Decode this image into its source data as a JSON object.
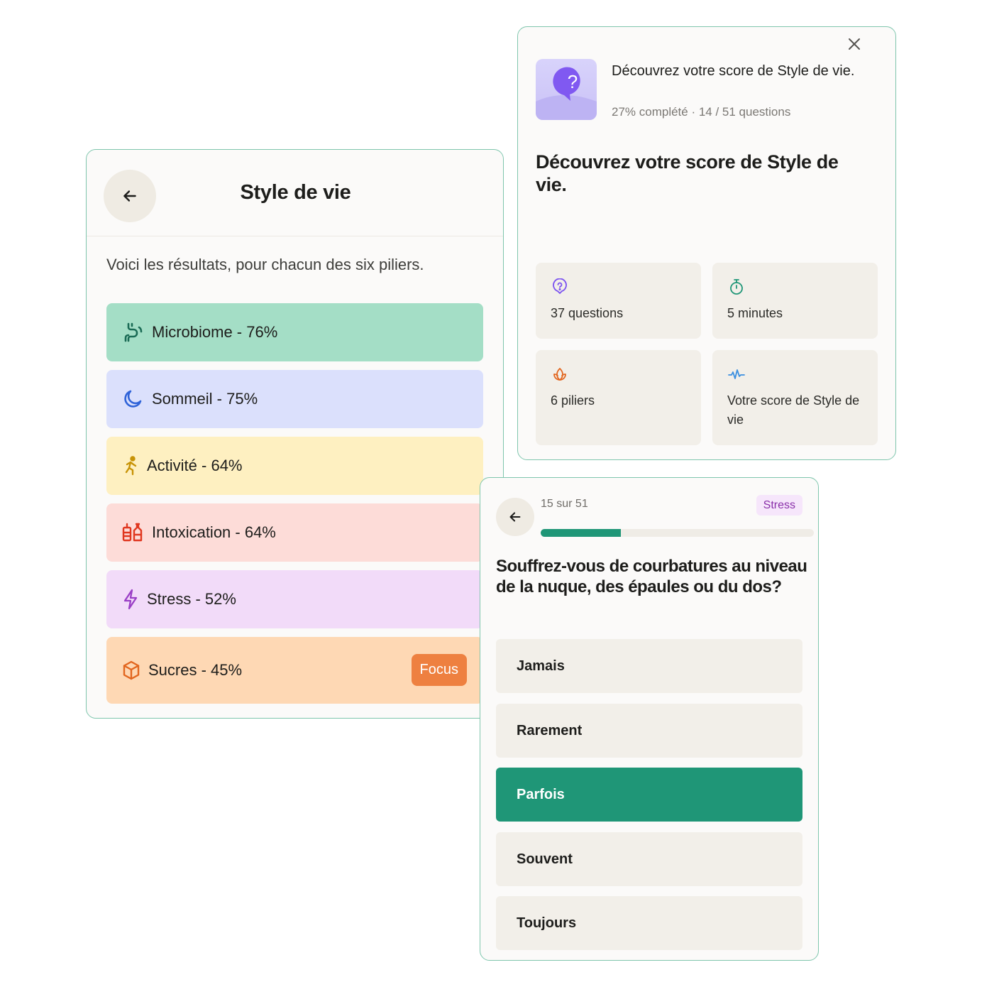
{
  "results": {
    "title": "Style de vie",
    "intro": "Voici les résultats, pour chacun des six piliers.",
    "pillars": [
      {
        "label": "Microbiome - 76%",
        "icon": "microbiome-icon",
        "bg": "#a4dec6",
        "color": "#1a6b55"
      },
      {
        "label": "Sommeil - 75%",
        "icon": "moon-icon",
        "bg": "#dbe0fc",
        "color": "#2f63d8"
      },
      {
        "label": "Activité - 64%",
        "icon": "running-icon",
        "bg": "#fef0c1",
        "color": "#c79306"
      },
      {
        "label": "Intoxication - 64%",
        "icon": "bottles-icon",
        "bg": "#fddcd8",
        "color": "#e0371f"
      },
      {
        "label": "Stress - 52%",
        "icon": "lightning-icon",
        "bg": "#f2dbf9",
        "color": "#9a3fc6"
      },
      {
        "label": "Sucres - 45%",
        "icon": "cube-icon",
        "bg": "#fed8b4",
        "color": "#e2661f"
      }
    ],
    "focus_label": "Focus"
  },
  "intro": {
    "header_title": "Découvrez votre score de Style de vie.",
    "progress_text": "27% complété · 14 / 51 questions",
    "big_title": "Découvrez votre score de Style de vie.",
    "tiles": [
      {
        "label": "37 questions",
        "icon": "question-circle-icon"
      },
      {
        "label": "5 minutes",
        "icon": "stopwatch-icon"
      },
      {
        "label": "6 piliers",
        "icon": "lotus-icon"
      },
      {
        "label": "Votre score de Style de vie",
        "icon": "pulse-icon"
      }
    ]
  },
  "question": {
    "counter": "15 sur 51",
    "tag": "Stress",
    "progress": 0.294,
    "text": "Souffrez-vous de courbatures au niveau de la nuque, des épaules ou du dos?",
    "options": [
      "Jamais",
      "Rarement",
      "Parfois",
      "Souvent",
      "Toujours"
    ],
    "selected": "Parfois"
  }
}
